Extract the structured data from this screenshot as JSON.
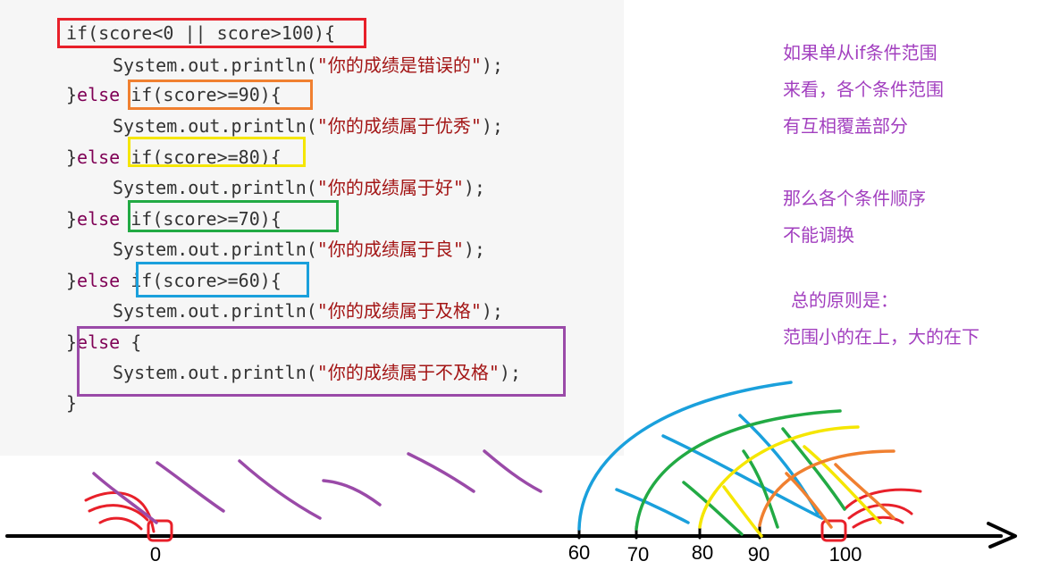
{
  "code": {
    "lines": [
      {
        "indent": 0,
        "parts": [
          {
            "t": "if(score<0 || score>100){",
            "c": "plain"
          }
        ]
      },
      {
        "indent": 1,
        "parts": [
          {
            "t": "System.out.println(",
            "c": "plain"
          },
          {
            "t": "\"你的成绩是错误的\"",
            "c": "str"
          },
          {
            "t": ");",
            "c": "plain"
          }
        ]
      },
      {
        "indent": 0,
        "parts": [
          {
            "t": "}",
            "c": "plain"
          },
          {
            "t": "else",
            "c": "kw"
          },
          {
            "t": " if(score>=90){",
            "c": "plain"
          }
        ]
      },
      {
        "indent": 1,
        "parts": [
          {
            "t": "System.out.println(",
            "c": "plain"
          },
          {
            "t": "\"你的成绩属于优秀\"",
            "c": "str"
          },
          {
            "t": ");",
            "c": "plain"
          }
        ]
      },
      {
        "indent": 0,
        "parts": [
          {
            "t": "}",
            "c": "plain"
          },
          {
            "t": "else",
            "c": "kw"
          },
          {
            "t": " if(score>=80){",
            "c": "plain"
          }
        ]
      },
      {
        "indent": 1,
        "parts": [
          {
            "t": "System.out.println(",
            "c": "plain"
          },
          {
            "t": "\"你的成绩属于好\"",
            "c": "str"
          },
          {
            "t": ");",
            "c": "plain"
          }
        ]
      },
      {
        "indent": 0,
        "parts": [
          {
            "t": "}",
            "c": "plain"
          },
          {
            "t": "else",
            "c": "kw"
          },
          {
            "t": " if(score>=70){",
            "c": "plain"
          }
        ]
      },
      {
        "indent": 1,
        "parts": [
          {
            "t": "System.out.println(",
            "c": "plain"
          },
          {
            "t": "\"你的成绩属于良\"",
            "c": "str"
          },
          {
            "t": ");",
            "c": "plain"
          }
        ]
      },
      {
        "indent": 0,
        "parts": [
          {
            "t": "}",
            "c": "plain"
          },
          {
            "t": "else",
            "c": "kw"
          },
          {
            "t": " if(score>=60){",
            "c": "plain"
          }
        ]
      },
      {
        "indent": 1,
        "parts": [
          {
            "t": "System.out.println(",
            "c": "plain"
          },
          {
            "t": "\"你的成绩属于及格\"",
            "c": "str"
          },
          {
            "t": ");",
            "c": "plain"
          }
        ]
      },
      {
        "indent": 0,
        "parts": [
          {
            "t": "}",
            "c": "plain"
          },
          {
            "t": "else",
            "c": "kw"
          },
          {
            "t": " {",
            "c": "plain"
          }
        ]
      },
      {
        "indent": 1,
        "parts": [
          {
            "t": "System.out.println(",
            "c": "plain"
          },
          {
            "t": "\"你的成绩属于不及格\"",
            "c": "str"
          },
          {
            "t": ");",
            "c": "plain"
          }
        ]
      },
      {
        "indent": 0,
        "parts": [
          {
            "t": "}",
            "c": "plain"
          }
        ]
      }
    ]
  },
  "highlight_colors": {
    "invalid": "#e8202a",
    "ge90": "#f08030",
    "ge80": "#f5e600",
    "ge70": "#22aa44",
    "ge60": "#1aa0dc",
    "else": "#9a4aa8"
  },
  "notes": {
    "block1": [
      "如果单从if条件范围",
      "来看，各个条件范围",
      "有互相覆盖部分"
    ],
    "block2": [
      "那么各个条件顺序",
      "不能调换"
    ],
    "block3": [
      "总的原则是：",
      "范围小的在上，大的在下"
    ]
  },
  "number_line": {
    "ticks": [
      "0",
      "60",
      "70",
      "80",
      "90",
      "100"
    ]
  }
}
